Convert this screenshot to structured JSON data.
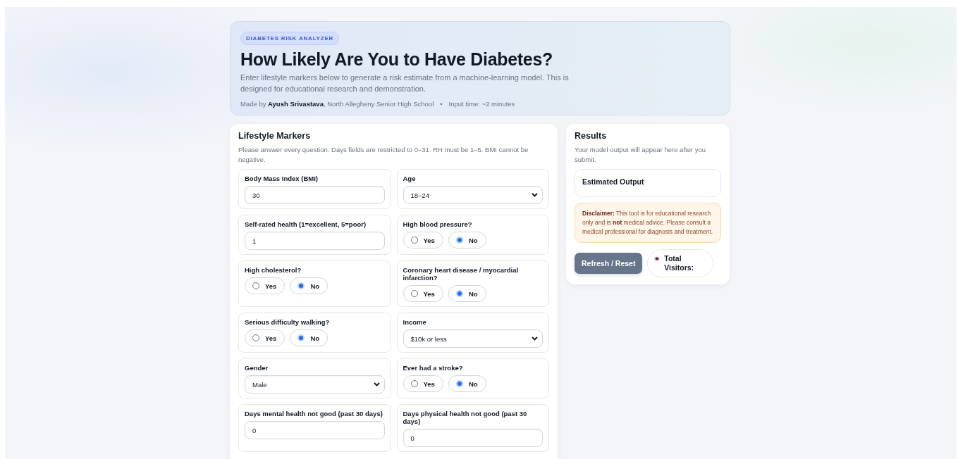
{
  "header": {
    "badge": "DIABETES RISK ANALYZER",
    "title": "How Likely Are You to Have Diabetes?",
    "description": "Enter lifestyle markers below to generate a risk estimate from a machine-learning model. This is designed for educational research and demonstration.",
    "credit": "Made by **Ayush Srivastava**, North Allegheny Senior High School",
    "separator": "•",
    "input_time": "Input time: ~2 minutes"
  },
  "form": {
    "title": "Lifestyle Markers",
    "instructions": "Please answer every question. Days fields are restricted to 0–31. RH must be 1–5. BMI cannot be negative.",
    "fields": [
      {
        "kind": "number",
        "label": "Body Mass Index (BMI)",
        "value": "30"
      },
      {
        "kind": "select",
        "label": "Age",
        "value": "18–24"
      },
      {
        "kind": "number",
        "label": "Self-rated health (1=excellent, 5=poor)",
        "value": "1"
      },
      {
        "kind": "radio",
        "label": "High blood pressure?",
        "options": [
          {
            "label": "Yes",
            "selected": false
          },
          {
            "label": "No",
            "selected": true
          }
        ]
      },
      {
        "kind": "radio",
        "label": "High cholesterol?",
        "options": [
          {
            "label": "Yes",
            "selected": false
          },
          {
            "label": "No",
            "selected": true
          }
        ]
      },
      {
        "kind": "radio",
        "label": "Coronary heart disease / myocardial infarction?",
        "options": [
          {
            "label": "Yes",
            "selected": false
          },
          {
            "label": "No",
            "selected": true
          }
        ]
      },
      {
        "kind": "radio",
        "label": "Serious difficulty walking?",
        "options": [
          {
            "label": "Yes",
            "selected": false
          },
          {
            "label": "No",
            "selected": true
          }
        ]
      },
      {
        "kind": "select",
        "label": "Income",
        "value": "$10k or less"
      },
      {
        "kind": "select",
        "label": "Gender",
        "value": "Male"
      },
      {
        "kind": "radio",
        "label": "Ever had a stroke?",
        "options": [
          {
            "label": "Yes",
            "selected": false
          },
          {
            "label": "No",
            "selected": true
          }
        ]
      },
      {
        "kind": "number",
        "label": "Days mental health not good (past 30 days)",
        "value": "0"
      },
      {
        "kind": "number",
        "label": "Days physical health not good (past 30 days)",
        "value": "0"
      }
    ]
  },
  "results": {
    "title": "Results",
    "subtitle": "Your model output will appear here after you submit.",
    "output_label": "Estimated Output",
    "disclaimer": "**Disclaimer:** This tool is for educational research only and is **not** medical advice. Please consult a medical professional for diagnosis and treatment.",
    "reset_button": "Refresh / Reset",
    "visitors_label": "Total Visitors:"
  }
}
